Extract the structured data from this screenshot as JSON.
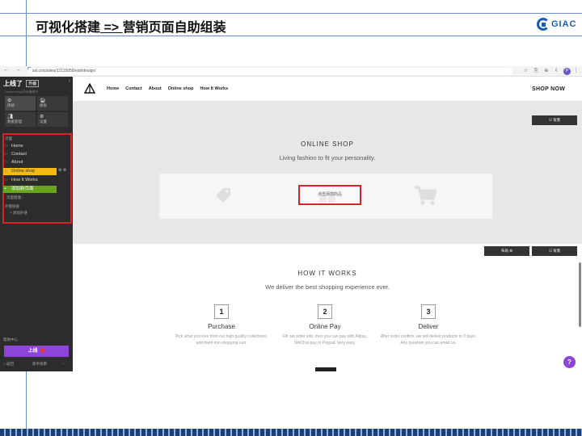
{
  "slide": {
    "title_left": "可视化搭建",
    "title_arrow": " => ",
    "title_right": "营销页面自助组装",
    "logo_text": "GIAC"
  },
  "browser": {
    "url": "sxl.cn/s/sites/12115058/edit/design/",
    "nav_glyphs": "← → C",
    "toolbar_glyphs": "☆ ⎘ ⊕ ⇩",
    "avatar_letter": "P",
    "menu_glyph": "⋮"
  },
  "editor": {
    "brand": "上线了",
    "version_tag": "升级",
    "close_glyph": "‹",
    "subtitle": "Online shop网站编辑中",
    "tools": [
      {
        "icon": "⚙",
        "label": "风格"
      },
      {
        "icon": "🏠︎",
        "label": "模板"
      },
      {
        "icon": "👥︎",
        "label": "数据管理"
      },
      {
        "icon": "⚙",
        "label": "设置"
      }
    ],
    "pages_label": "页面",
    "pages": [
      "Home",
      "Contact",
      "About",
      "Online shop",
      "How It Works"
    ],
    "add_page": "添加新页面",
    "manage_link": "页面管理 ›",
    "ext_label": "外部链接",
    "ext_add": "+ 添加外链",
    "selected_tools": "⚙ ⚙",
    "help_row": "帮助中心",
    "publish_label": "上线",
    "footer_left": "⌂ 返回",
    "footer_mid": "新手指南",
    "footer_right": "···"
  },
  "site": {
    "nav": [
      "Home",
      "Contact",
      "About",
      "Online shop",
      "How It Works"
    ],
    "shop_now": "SHOP NOW",
    "bg_button": "☷ 背景",
    "hero_title": "ONLINE SHOP",
    "hero_sub": "Living fashion to fit your personality.",
    "add_product": "点击添加商品",
    "layout_button": "布局 ⚙",
    "bg_button_2": "☷ 背景",
    "how_title": "HOW IT WORKS",
    "how_sub": "We deliver the best shopping experience ever.",
    "steps": [
      {
        "num": "1",
        "title": "Purchase",
        "desc": "Pick what you love from our high quality collections, add them into shopping cart."
      },
      {
        "num": "2",
        "title": "Online Pay",
        "desc": "Fill out order info, then you can pay with Alipay, WeChat pay or Paypal. Very easy."
      },
      {
        "num": "3",
        "title": "Deliver",
        "desc": "After order confirm, we will deliver products in 3 days. Any question you can email us."
      }
    ],
    "help_glyph": "?"
  },
  "colors": {
    "accent_purple": "#8d45d9",
    "highlight_red": "#d82424",
    "selected_yellow": "#f5b915",
    "add_green": "#67a520",
    "editor_bg": "#2c2c2c"
  }
}
